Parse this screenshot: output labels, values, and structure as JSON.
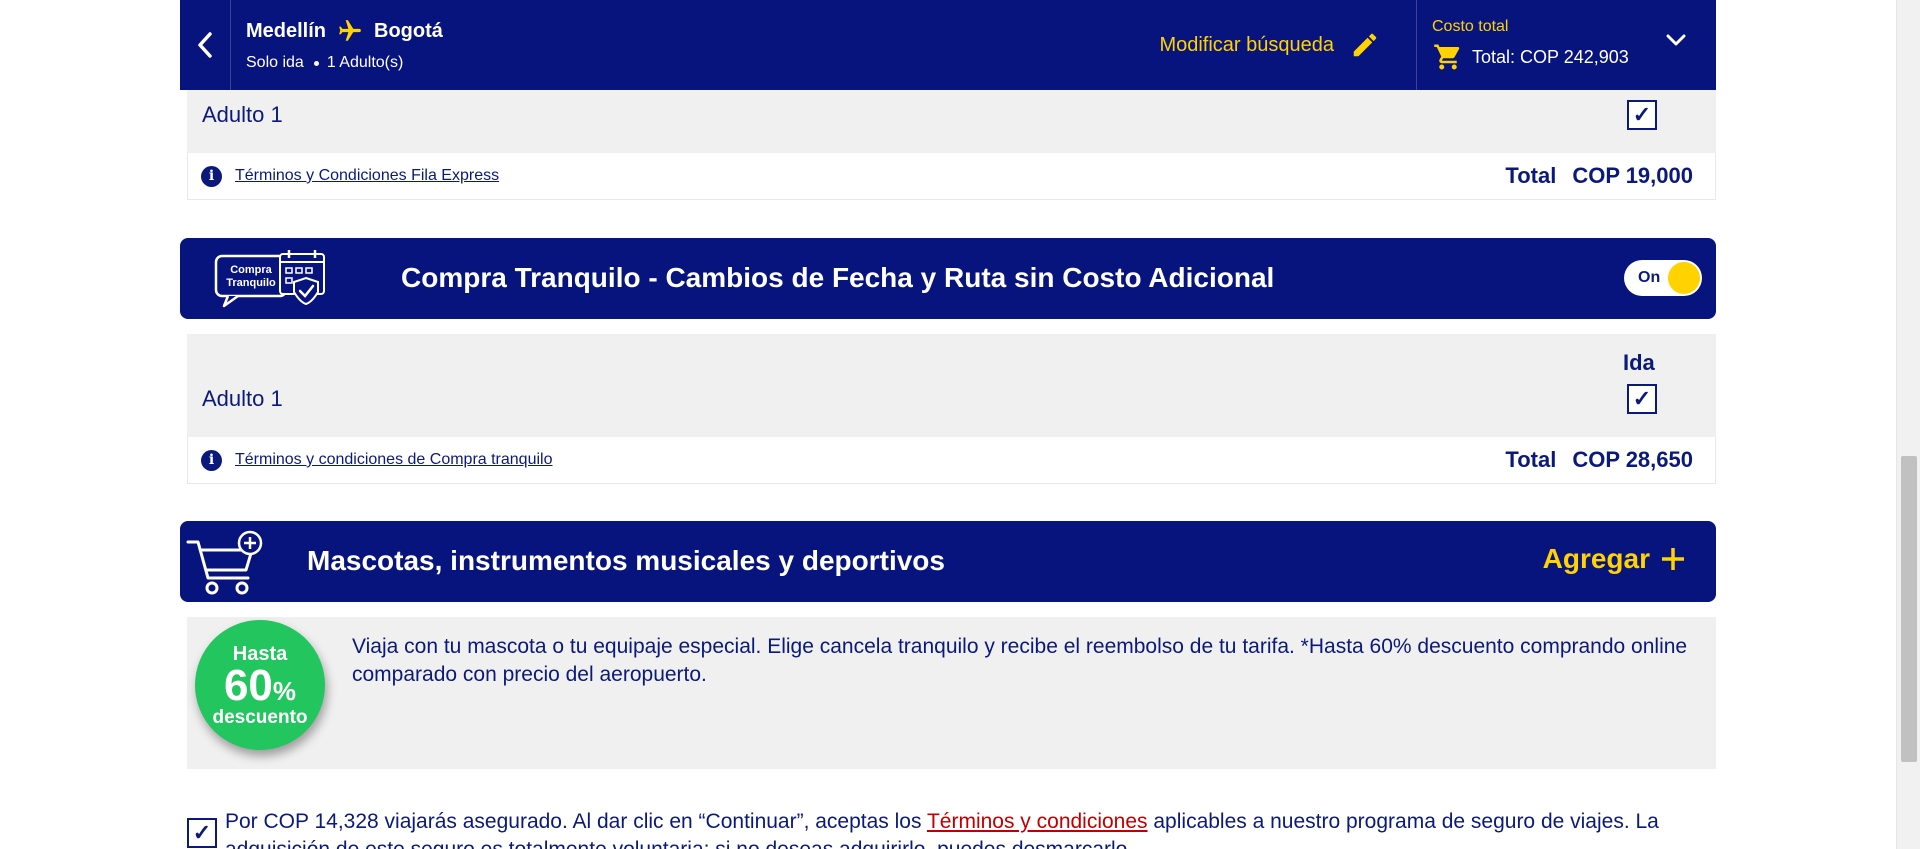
{
  "header": {
    "origin": "Medellín",
    "destination": "Bogotá",
    "trip_type": "Solo ida",
    "passengers": "1 Adulto(s)",
    "modify_label": "Modificar búsqueda",
    "total_cost_label": "Costo total",
    "total_value": "Total: COP 242,903"
  },
  "fila_express": {
    "adult_label": "Adulto 1",
    "checked": true,
    "terms_link": "Términos y Condiciones Fila Express",
    "total_label": "Total",
    "total_value": "COP 19,000"
  },
  "compra_tranquilo": {
    "logo_text": "Compra Tranquilo",
    "title": "Compra Tranquilo - Cambios de Fecha y Ruta sin Costo Adicional",
    "toggle_label": "On",
    "direction_label": "Ida",
    "adult_label": "Adulto 1",
    "checked": true,
    "terms_link": "Términos y condiciones de Compra tranquilo",
    "total_label": "Total",
    "total_value": "COP 28,650"
  },
  "mascotas": {
    "title": "Mascotas, instrumentos musicales y deportivos",
    "add_label": "Agregar",
    "badge_top": "Hasta",
    "badge_number": "60",
    "badge_percent": "%",
    "badge_bottom": "descuento",
    "description": "Viaja con tu mascota o tu equipaje especial. Elige cancela tranquilo y recibe el reembolso de tu tarifa. *Hasta 60% descuento comprando online comparado con precio del aeropuerto."
  },
  "insurance": {
    "checked": true,
    "text_before": "Por COP 14,328 viajarás asegurado. Al dar clic en “Continuar”, aceptas los ",
    "link": "Términos y condiciones",
    "text_after": " aplicables a nuestro programa de seguro de viajes. La adquisición de este seguro es totalmente voluntaria; si no deseas adquirirlo, puedes desmarcarlo."
  },
  "colors": {
    "navy": "#08147e",
    "yellow": "#ffd200",
    "green": "#22c55e",
    "link_red": "#c00000"
  }
}
